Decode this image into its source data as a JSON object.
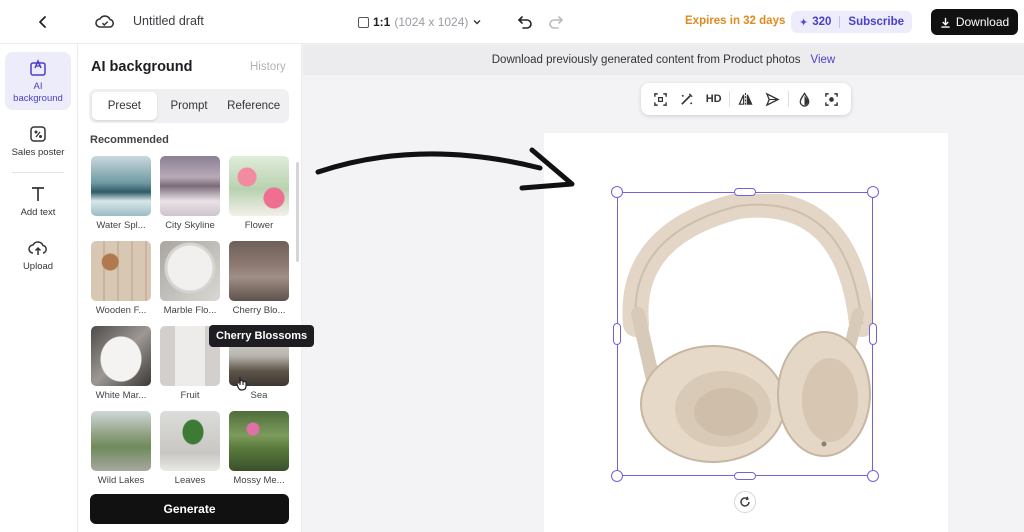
{
  "topbar": {
    "title": "Untitled draft",
    "ratio": "1:1",
    "dims": "(1024 x 1024)",
    "expires": "Expires in 32 days",
    "credits": "320",
    "subscribe": "Subscribe",
    "download": "Download"
  },
  "rail": {
    "items": [
      {
        "label": "AI background",
        "icon": "ai-background-icon"
      },
      {
        "label": "Sales poster",
        "icon": "sales-poster-icon"
      },
      {
        "label": "Add text",
        "icon": "text-icon"
      },
      {
        "label": "Upload",
        "icon": "upload-icon"
      }
    ]
  },
  "panel": {
    "title": "AI background",
    "history": "History",
    "tabs": [
      "Preset",
      "Prompt",
      "Reference"
    ],
    "section": "Recommended",
    "presets": [
      "Water Spl...",
      "City Skyline",
      "Flower",
      "Wooden F...",
      "Marble Flo...",
      "Cherry Blo...",
      "White Mar...",
      "Fruit",
      "Sea",
      "Wild Lakes",
      "Leaves",
      "Mossy Me..."
    ],
    "generate": "Generate"
  },
  "tooltip": "Cherry Blossoms",
  "canvas": {
    "banner_text": "Download previously generated content from Product photos",
    "banner_link": "View",
    "tools": [
      "crop-icon",
      "magic-brush-icon",
      "HD",
      "flip-icon",
      "send-icon",
      "drop-icon",
      "cutout-icon"
    ]
  },
  "colors": {
    "accent": "#4a3fc9",
    "selection": "#7463d6",
    "expires": "#e08a1e"
  }
}
